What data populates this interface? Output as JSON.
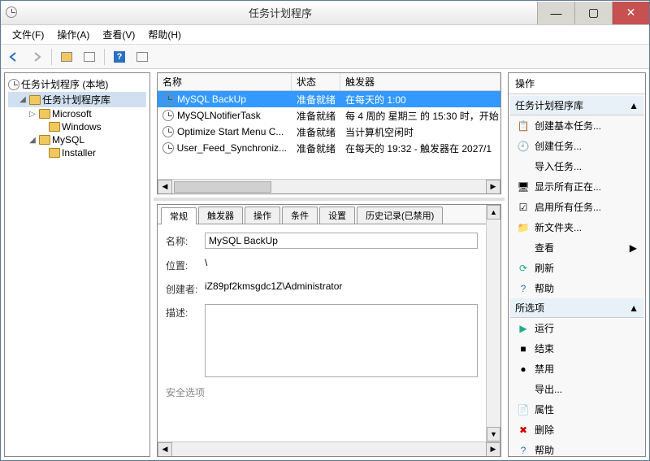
{
  "window": {
    "title": "任务计划程序"
  },
  "menubar": [
    "文件(F)",
    "操作(A)",
    "查看(V)",
    "帮助(H)"
  ],
  "tree": {
    "root": "任务计划程序 (本地)",
    "lib": "任务计划程序库",
    "items": [
      {
        "label": "Microsoft",
        "children": [
          "Windows"
        ]
      },
      {
        "label": "MySQL",
        "children": [
          "Installer"
        ]
      }
    ]
  },
  "list": {
    "headers": [
      "名称",
      "状态",
      "触发器"
    ],
    "rows": [
      {
        "name": "MySQL BackUp",
        "status": "准备就绪",
        "trigger": "在每天的 1:00",
        "selected": true
      },
      {
        "name": "MySQLNotifierTask",
        "status": "准备就绪",
        "trigger": "每 4 周的 星期三 的 15:30 时，开始"
      },
      {
        "name": "Optimize Start Menu C...",
        "status": "准备就绪",
        "trigger": "当计算机空闲时"
      },
      {
        "name": "User_Feed_Synchroniz...",
        "status": "准备就绪",
        "trigger": "在每天的 19:32 - 触发器在 2027/1"
      }
    ]
  },
  "tabs": [
    "常规",
    "触发器",
    "操作",
    "条件",
    "设置",
    "历史记录(已禁用)"
  ],
  "detail": {
    "name_label": "名称:",
    "name_value": "MySQL BackUp",
    "location_label": "位置:",
    "location_value": "\\",
    "author_label": "创建者:",
    "author_value": "iZ89pf2kmsgdc1Z\\Administrator",
    "desc_label": "描述:",
    "security_label": "安全选项"
  },
  "actions": {
    "header": "操作",
    "section1": "任务计划程序库",
    "items1": [
      "创建基本任务...",
      "创建任务...",
      "导入任务...",
      "显示所有正在...",
      "启用所有任务...",
      "新文件夹...",
      "查看",
      "刷新",
      "帮助"
    ],
    "section2": "所选项",
    "items2": [
      "运行",
      "结束",
      "禁用",
      "导出...",
      "属性",
      "删除",
      "帮助"
    ]
  }
}
